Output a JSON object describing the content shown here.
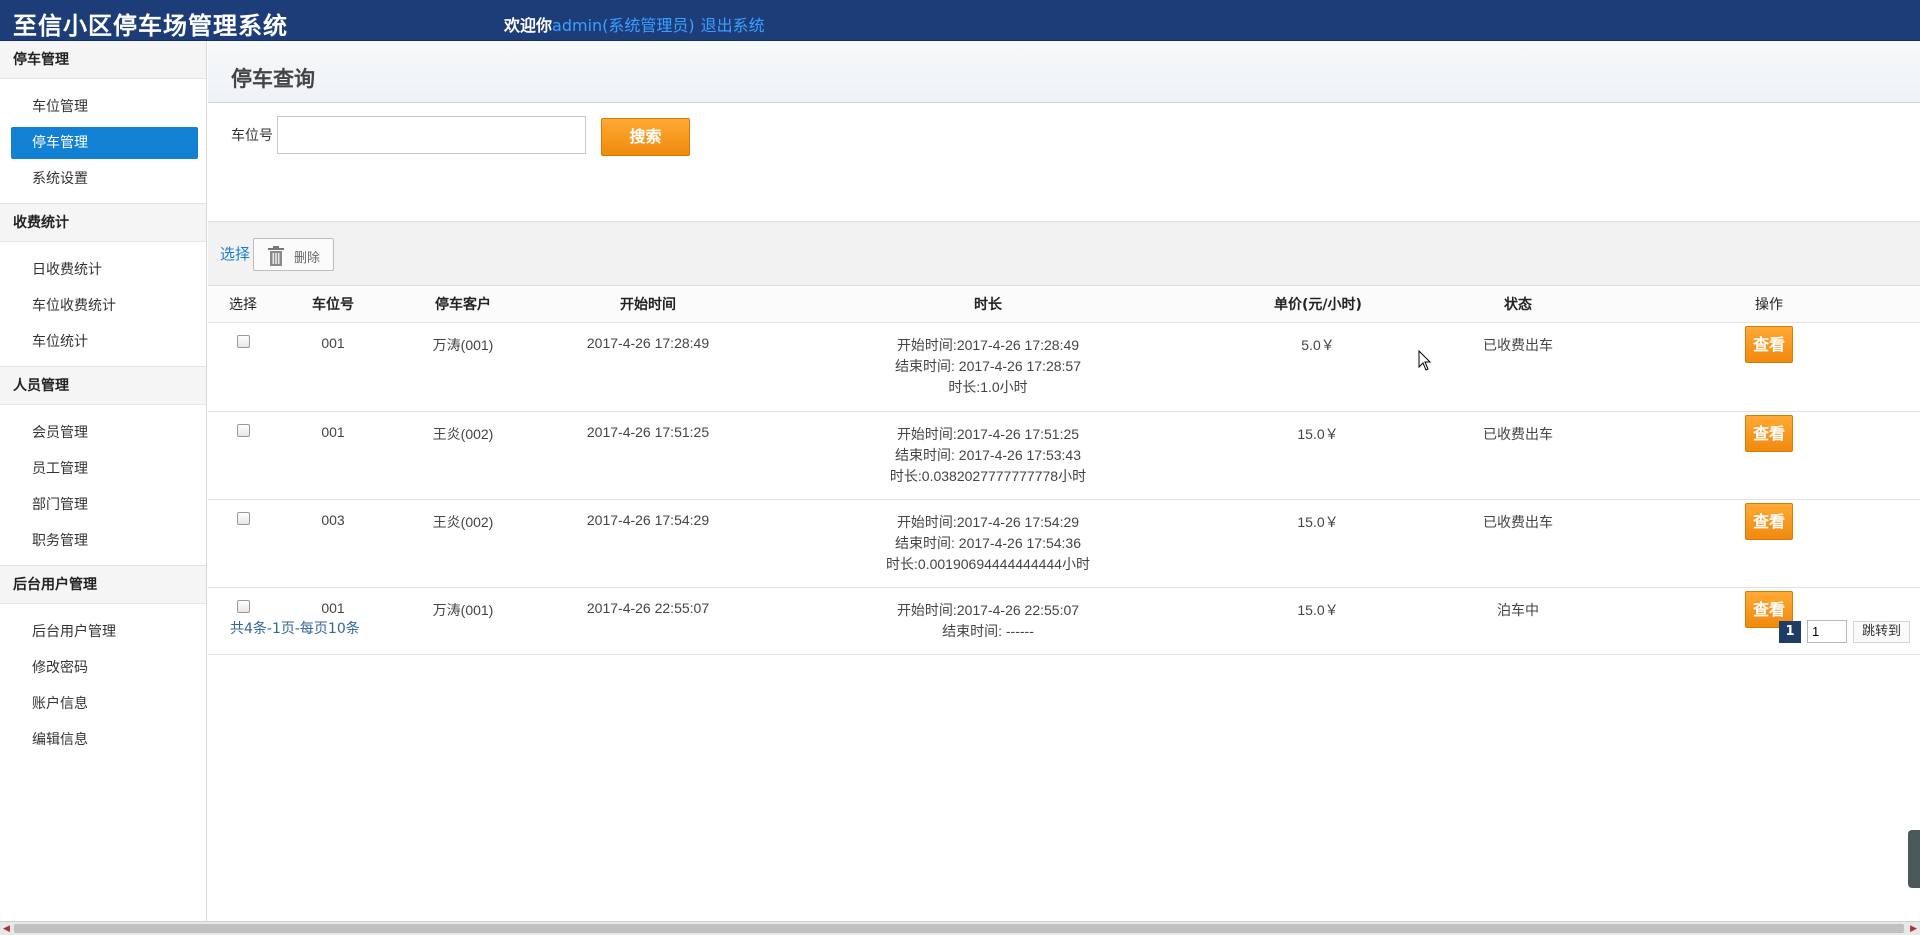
{
  "header": {
    "app_title": "至信小区停车场管理系统",
    "welcome_prefix": "欢迎你",
    "user": "admin(系统管理员)",
    "logout": "退出系统"
  },
  "sidebar": {
    "groups": [
      {
        "title": "停车管理",
        "items": [
          "车位管理",
          "停车管理",
          "系统设置"
        ]
      },
      {
        "title": "收费统计",
        "items": [
          "日收费统计",
          "车位收费统计",
          "车位统计"
        ]
      },
      {
        "title": "人员管理",
        "items": [
          "会员管理",
          "员工管理",
          "部门管理",
          "职务管理"
        ]
      },
      {
        "title": "后台用户管理",
        "items": [
          "后台用户管理",
          "修改密码",
          "账户信息",
          "编辑信息"
        ]
      }
    ],
    "active_item": "停车管理"
  },
  "page": {
    "title": "停车查询",
    "search": {
      "label": "车位号",
      "value": "",
      "placeholder": "",
      "button": "搜索"
    },
    "toolbar": {
      "select": "选择",
      "delete": "删除"
    }
  },
  "table": {
    "headers": [
      "选择",
      "车位号",
      "停车客户",
      "开始时间",
      "时长",
      "单价(元/小时)",
      "状态",
      "操作"
    ],
    "view_label": "查看",
    "rows": [
      {
        "space": "001",
        "customer": "万涛(001)",
        "start": "2017-4-26 17:28:49",
        "duration": [
          "开始时间:2017-4-26 17:28:49",
          "结束时间: 2017-4-26 17:28:57",
          "时长:1.0小时"
        ],
        "price": "5.0￥",
        "status": "已收费出车"
      },
      {
        "space": "001",
        "customer": "王炎(002)",
        "start": "2017-4-26 17:51:25",
        "duration": [
          "开始时间:2017-4-26 17:51:25",
          "结束时间: 2017-4-26 17:53:43",
          "时长:0.0382027777777778小时"
        ],
        "price": "15.0￥",
        "status": "已收费出车"
      },
      {
        "space": "003",
        "customer": "王炎(002)",
        "start": "2017-4-26 17:54:29",
        "duration": [
          "开始时间:2017-4-26 17:54:29",
          "结束时间: 2017-4-26 17:54:36",
          "时长:0.00190694444444444小时"
        ],
        "price": "15.0￥",
        "status": "已收费出车"
      },
      {
        "space": "001",
        "customer": "万涛(001)",
        "start": "2017-4-26 22:55:07",
        "duration": [
          "开始时间:2017-4-26 22:55:07",
          "结束时间: ------"
        ],
        "price": "15.0￥",
        "status": "泊车中"
      }
    ]
  },
  "pagination": {
    "summary": "共4条-1页-每页10条",
    "current_page": "1",
    "input_value": "1",
    "go_label": "跳转到"
  }
}
